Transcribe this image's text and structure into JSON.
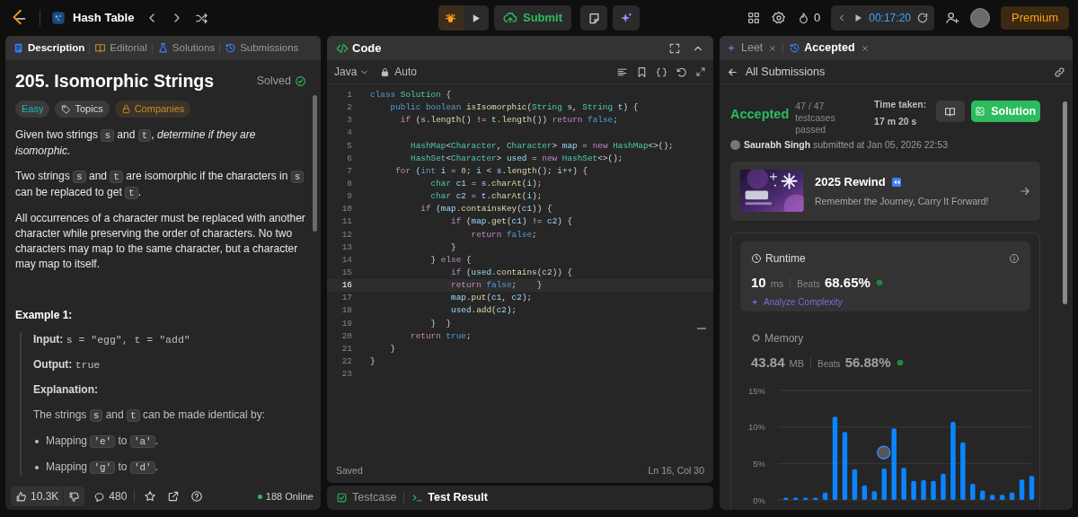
{
  "top_bar": {
    "problem_list": "Hash Table",
    "submit": "Submit",
    "streak": "0",
    "timer": "00:17:20",
    "premium": "Premium"
  },
  "description_panel": {
    "tabs": [
      {
        "label": "Description",
        "selected": true
      },
      {
        "label": "Editorial",
        "selected": false
      },
      {
        "label": "Solutions",
        "selected": false
      },
      {
        "label": "Submissions",
        "selected": false
      }
    ],
    "title": "205. Isomorphic Strings",
    "status": "Solved",
    "tags": [
      {
        "label": "Easy",
        "kind": "difficulty"
      },
      {
        "label": "Topics",
        "kind": "topics"
      },
      {
        "label": "Companies",
        "kind": "companies"
      }
    ],
    "paragraphs": [
      [
        {
          "t": "Given two strings ",
          "kind": "text"
        },
        {
          "t": "s",
          "kind": "code"
        },
        {
          "t": " and ",
          "kind": "text"
        },
        {
          "t": "t",
          "kind": "code"
        },
        {
          "t": ", ",
          "kind": "text"
        },
        {
          "t": "determine if they are isomorphic.",
          "kind": "em"
        }
      ],
      [
        {
          "t": "Two strings ",
          "kind": "text"
        },
        {
          "t": "s",
          "kind": "code"
        },
        {
          "t": " and ",
          "kind": "text"
        },
        {
          "t": "t",
          "kind": "code"
        },
        {
          "t": " are isomorphic if the characters in ",
          "kind": "text"
        },
        {
          "t": "s",
          "kind": "code"
        },
        {
          "t": " can be replaced to get ",
          "kind": "text"
        },
        {
          "t": "t",
          "kind": "code"
        },
        {
          "t": ".",
          "kind": "text"
        }
      ],
      [
        {
          "t": "All occurrences of a character must be replaced with another character while preserving the order of characters. No two characters may map to the same character, but a character may map to itself.",
          "kind": "text"
        }
      ]
    ],
    "example": {
      "heading": "Example 1:",
      "input_label": "Input:",
      "input": "s = \"egg\", t = \"add\"",
      "output_label": "Output:",
      "output": "true",
      "explanation_label": "Explanation:",
      "explanation": [
        {
          "t": "The strings ",
          "kind": "text"
        },
        {
          "t": "s",
          "kind": "code"
        },
        {
          "t": " and ",
          "kind": "text"
        },
        {
          "t": "t",
          "kind": "code"
        },
        {
          "t": " can be made identical by:",
          "kind": "text"
        }
      ],
      "bullets": [
        [
          {
            "t": "Mapping ",
            "kind": "text"
          },
          {
            "t": "'e'",
            "kind": "code"
          },
          {
            "t": " to ",
            "kind": "text"
          },
          {
            "t": "'a'",
            "kind": "code"
          },
          {
            "t": ".",
            "kind": "text"
          }
        ],
        [
          {
            "t": "Mapping ",
            "kind": "text"
          },
          {
            "t": "'g'",
            "kind": "code"
          },
          {
            "t": " to ",
            "kind": "text"
          },
          {
            "t": "'d'",
            "kind": "code"
          },
          {
            "t": ".",
            "kind": "text"
          }
        ]
      ]
    },
    "footer": {
      "likes": "10.3K",
      "comments": "480",
      "online": "188 Online"
    }
  },
  "code_panel": {
    "title": "Code",
    "language": "Java",
    "mode": "Auto",
    "status": "Saved",
    "cursor": "Ln 16, Col 30",
    "lines": [
      {
        "number": "1",
        "active": false,
        "tokens": [
          {
            "t": "class ",
            "kind": "keyword"
          },
          {
            "t": "Solution",
            "kind": "type"
          },
          {
            "t": " {",
            "kind": "plain"
          }
        ]
      },
      {
        "number": "2",
        "active": false,
        "tokens": [
          {
            "t": "    public boolean ",
            "kind": "keyword"
          },
          {
            "t": "isIsomorphic",
            "kind": "function"
          },
          {
            "t": "(",
            "kind": "plain"
          },
          {
            "t": "String ",
            "kind": "type"
          },
          {
            "t": "s",
            "kind": "variable"
          },
          {
            "t": ", ",
            "kind": "plain"
          },
          {
            "t": "String ",
            "kind": "type"
          },
          {
            "t": "t",
            "kind": "variable"
          },
          {
            "t": ") {",
            "kind": "plain"
          }
        ]
      },
      {
        "number": "3",
        "active": false,
        "tokens": [
          {
            "t": "      if ",
            "kind": "control"
          },
          {
            "t": "(",
            "kind": "plain"
          },
          {
            "t": "s",
            "kind": "variable"
          },
          {
            "t": ".",
            "kind": "plain"
          },
          {
            "t": "length",
            "kind": "function"
          },
          {
            "t": "() != ",
            "kind": "plain"
          },
          {
            "t": "t",
            "kind": "variable"
          },
          {
            "t": ".",
            "kind": "plain"
          },
          {
            "t": "length",
            "kind": "function"
          },
          {
            "t": "()) ",
            "kind": "plain"
          },
          {
            "t": "return ",
            "kind": "control"
          },
          {
            "t": "false",
            "kind": "keyword"
          },
          {
            "t": ";",
            "kind": "plain"
          }
        ]
      },
      {
        "number": "4",
        "active": false
      },
      {
        "number": "5",
        "active": false,
        "tokens": [
          {
            "t": "        HashMap",
            "kind": "type"
          },
          {
            "t": "<",
            "kind": "plain"
          },
          {
            "t": "Character",
            "kind": "type"
          },
          {
            "t": ", ",
            "kind": "plain"
          },
          {
            "t": "Character",
            "kind": "type"
          },
          {
            "t": "> ",
            "kind": "plain"
          },
          {
            "t": "map",
            "kind": "variable"
          },
          {
            "t": " = ",
            "kind": "plain"
          },
          {
            "t": "new ",
            "kind": "control"
          },
          {
            "t": "HashMap",
            "kind": "type"
          },
          {
            "t": "<>();",
            "kind": "plain"
          }
        ]
      },
      {
        "number": "6",
        "active": false,
        "tokens": [
          {
            "t": "        HashSet",
            "kind": "type"
          },
          {
            "t": "<",
            "kind": "plain"
          },
          {
            "t": "Character",
            "kind": "type"
          },
          {
            "t": "> ",
            "kind": "plain"
          },
          {
            "t": "used",
            "kind": "variable"
          },
          {
            "t": " = ",
            "kind": "plain"
          },
          {
            "t": "new ",
            "kind": "control"
          },
          {
            "t": "HashSet",
            "kind": "type"
          },
          {
            "t": "<>();",
            "kind": "plain"
          }
        ]
      },
      {
        "number": "7",
        "active": false,
        "tokens": [
          {
            "t": "     for ",
            "kind": "control"
          },
          {
            "t": "(",
            "kind": "plain"
          },
          {
            "t": "int ",
            "kind": "keyword"
          },
          {
            "t": "i",
            "kind": "variable"
          },
          {
            "t": " = ",
            "kind": "plain"
          },
          {
            "t": "0",
            "kind": "number"
          },
          {
            "t": "; ",
            "kind": "plain"
          },
          {
            "t": "i",
            "kind": "variable"
          },
          {
            "t": " < ",
            "kind": "plain"
          },
          {
            "t": "s",
            "kind": "variable"
          },
          {
            "t": ".",
            "kind": "plain"
          },
          {
            "t": "length",
            "kind": "function"
          },
          {
            "t": "(); ",
            "kind": "plain"
          },
          {
            "t": "i",
            "kind": "variable"
          },
          {
            "t": "++) {",
            "kind": "plain"
          }
        ]
      },
      {
        "number": "8",
        "active": false,
        "tokens": [
          {
            "t": "            char ",
            "kind": "type"
          },
          {
            "t": "c1",
            "kind": "variable"
          },
          {
            "t": " = ",
            "kind": "plain"
          },
          {
            "t": "s",
            "kind": "variable"
          },
          {
            "t": ".",
            "kind": "plain"
          },
          {
            "t": "charAt",
            "kind": "function"
          },
          {
            "t": "(",
            "kind": "plain"
          },
          {
            "t": "i",
            "kind": "variable"
          },
          {
            "t": ");",
            "kind": "plain"
          }
        ]
      },
      {
        "number": "9",
        "active": false,
        "tokens": [
          {
            "t": "            char ",
            "kind": "type"
          },
          {
            "t": "c2",
            "kind": "variable"
          },
          {
            "t": " = ",
            "kind": "plain"
          },
          {
            "t": "t",
            "kind": "variable"
          },
          {
            "t": ".",
            "kind": "plain"
          },
          {
            "t": "charAt",
            "kind": "function"
          },
          {
            "t": "(",
            "kind": "plain"
          },
          {
            "t": "i",
            "kind": "variable"
          },
          {
            "t": ");",
            "kind": "plain"
          }
        ]
      },
      {
        "number": "10",
        "active": false,
        "tokens": [
          {
            "t": "          if ",
            "kind": "control"
          },
          {
            "t": "(",
            "kind": "plain"
          },
          {
            "t": "map",
            "kind": "variable"
          },
          {
            "t": ".",
            "kind": "plain"
          },
          {
            "t": "containsKey",
            "kind": "function"
          },
          {
            "t": "(",
            "kind": "plain"
          },
          {
            "t": "c1",
            "kind": "variable"
          },
          {
            "t": ")) {",
            "kind": "plain"
          }
        ]
      },
      {
        "number": "11",
        "active": false,
        "tokens": [
          {
            "t": "                if ",
            "kind": "control"
          },
          {
            "t": "(",
            "kind": "plain"
          },
          {
            "t": "map",
            "kind": "variable"
          },
          {
            "t": ".",
            "kind": "plain"
          },
          {
            "t": "get",
            "kind": "function"
          },
          {
            "t": "(",
            "kind": "plain"
          },
          {
            "t": "c1",
            "kind": "variable"
          },
          {
            "t": ") != ",
            "kind": "plain"
          },
          {
            "t": "c2",
            "kind": "variable"
          },
          {
            "t": ") {",
            "kind": "plain"
          }
        ]
      },
      {
        "number": "12",
        "active": false,
        "tokens": [
          {
            "t": "                    return ",
            "kind": "control"
          },
          {
            "t": "false",
            "kind": "keyword"
          },
          {
            "t": ";",
            "kind": "plain"
          }
        ]
      },
      {
        "number": "13",
        "active": false,
        "tokens": [
          {
            "t": "                }",
            "kind": "plain"
          }
        ]
      },
      {
        "number": "14",
        "active": false,
        "tokens": [
          {
            "t": "            } ",
            "kind": "plain"
          },
          {
            "t": "else ",
            "kind": "control"
          },
          {
            "t": "{",
            "kind": "plain"
          }
        ]
      },
      {
        "number": "15",
        "active": false,
        "tokens": [
          {
            "t": "                if ",
            "kind": "control"
          },
          {
            "t": "(",
            "kind": "plain"
          },
          {
            "t": "used",
            "kind": "variable"
          },
          {
            "t": ".",
            "kind": "plain"
          },
          {
            "t": "contains",
            "kind": "function"
          },
          {
            "t": "(",
            "kind": "plain"
          },
          {
            "t": "c2",
            "kind": "variable"
          },
          {
            "t": ")) {",
            "kind": "plain"
          }
        ]
      },
      {
        "number": "16",
        "active": true,
        "tokens": [
          {
            "t": "                return ",
            "kind": "control"
          },
          {
            "t": "false",
            "kind": "keyword"
          },
          {
            "t": ";    }",
            "kind": "plain"
          }
        ]
      },
      {
        "number": "17",
        "active": false,
        "tokens": [
          {
            "t": "                map",
            "kind": "variable"
          },
          {
            "t": ".",
            "kind": "plain"
          },
          {
            "t": "put",
            "kind": "function"
          },
          {
            "t": "(",
            "kind": "plain"
          },
          {
            "t": "c1",
            "kind": "variable"
          },
          {
            "t": ", ",
            "kind": "plain"
          },
          {
            "t": "c2",
            "kind": "variable"
          },
          {
            "t": ");",
            "kind": "plain"
          }
        ]
      },
      {
        "number": "18",
        "active": false,
        "tokens": [
          {
            "t": "                used",
            "kind": "variable"
          },
          {
            "t": ".",
            "kind": "plain"
          },
          {
            "t": "add",
            "kind": "function"
          },
          {
            "t": "(",
            "kind": "plain"
          },
          {
            "t": "c2",
            "kind": "variable"
          },
          {
            "t": ");",
            "kind": "plain"
          }
        ]
      },
      {
        "number": "19",
        "active": false,
        "tokens": [
          {
            "t": "            }  }",
            "kind": "plain"
          }
        ]
      },
      {
        "number": "20",
        "active": false,
        "tokens": [
          {
            "t": "        return ",
            "kind": "control"
          },
          {
            "t": "true",
            "kind": "keyword"
          },
          {
            "t": ";",
            "kind": "plain"
          }
        ]
      },
      {
        "number": "21",
        "active": false,
        "tokens": [
          {
            "t": "    }",
            "kind": "plain"
          }
        ]
      },
      {
        "number": "22",
        "active": false,
        "tokens": [
          {
            "t": "}",
            "kind": "plain"
          }
        ]
      },
      {
        "number": "23",
        "active": false
      }
    ]
  },
  "bottom_tabs": [
    {
      "label": "Testcase",
      "selected": false
    },
    {
      "label": "Test Result",
      "selected": true
    }
  ],
  "result_panel": {
    "tabs": [
      {
        "label": "Leet",
        "selected": false
      },
      {
        "label": "Accepted",
        "selected": true
      }
    ],
    "back_link": "All Submissions",
    "verdict": "Accepted",
    "testcases": "47 / 47 testcases passed",
    "time_taken": "Time taken: 17 m 20 s",
    "solution_button": "Solution",
    "submitted": "**Saurabh Singh** submitted at Jan 05, 2026 22:53",
    "promo": {
      "kind": "picture",
      "title": "2025 Rewind",
      "subtitle": "Remember the Journey, Carry It Forward!"
    },
    "runtime": {
      "label": "Runtime",
      "value": "10",
      "unit": "ms",
      "beats_label": "Beats",
      "beats": "68.65%",
      "analyze": "Analyze Complexity"
    },
    "memory": {
      "label": "Memory",
      "value": "43.84",
      "unit": "MB",
      "beats_label": "Beats",
      "beats": "56.88%",
      "chart_data": {
        "type": "bar",
        "ylim": [
          0,
          15
        ],
        "yticks": [
          {
            "value": 0,
            "label": "0%"
          },
          {
            "value": 5,
            "label": "5%"
          },
          {
            "value": 10,
            "label": "10%"
          },
          {
            "value": 15,
            "label": "15%"
          }
        ],
        "values": [
          0.3,
          0.3,
          0.3,
          0.3,
          1.0,
          11.4,
          9.3,
          4.2,
          2.0,
          1.2,
          4.3,
          9.8,
          4.4,
          2.6,
          2.7,
          2.6,
          3.6,
          10.7,
          7.9,
          2.2,
          1.3,
          0.7,
          0.7,
          1.0,
          2.8,
          3.3
        ]
      }
    }
  }
}
